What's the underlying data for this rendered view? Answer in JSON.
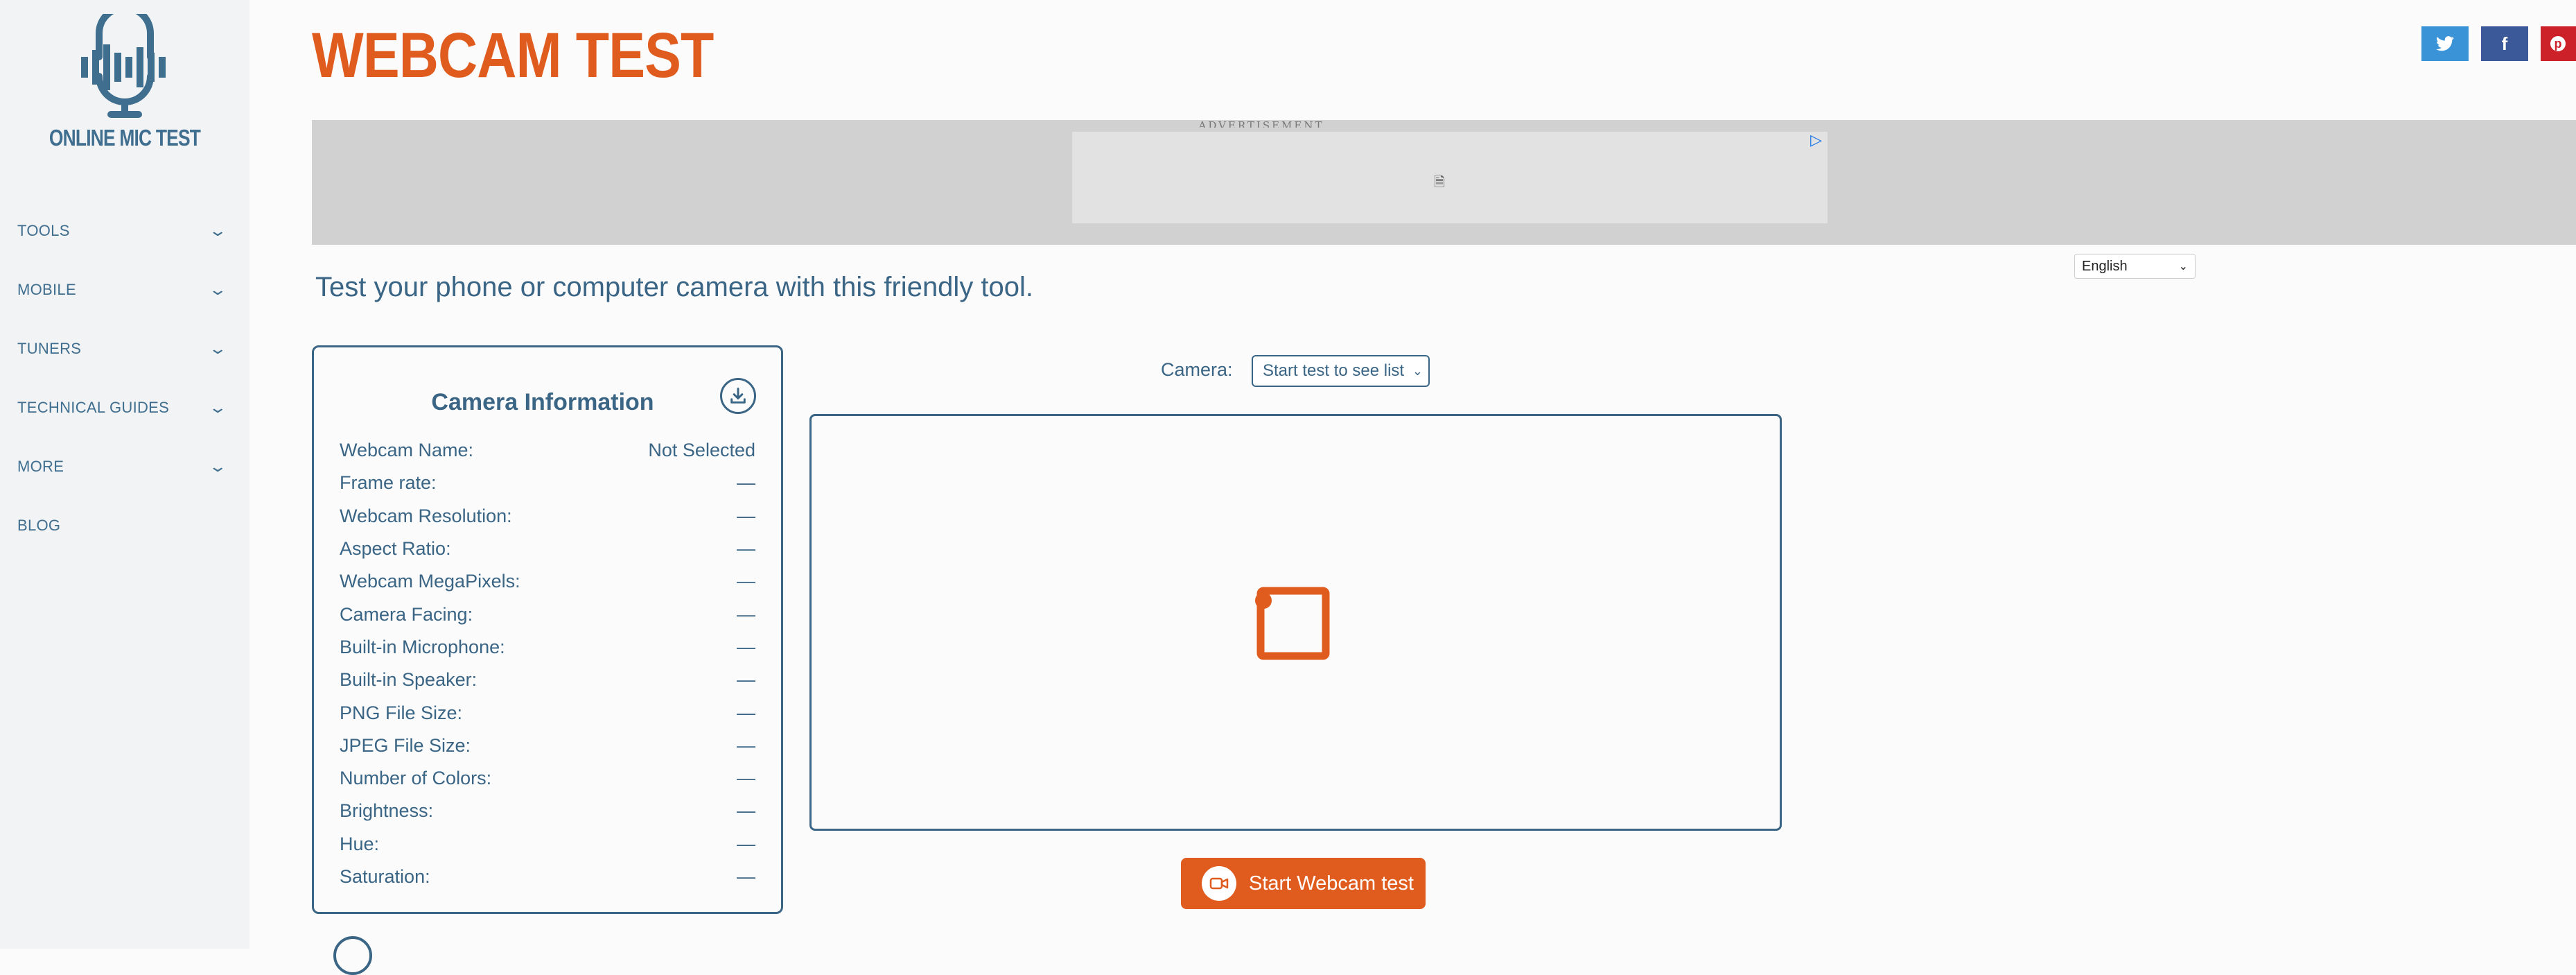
{
  "sidebar": {
    "logo_text": "ONLINE MIC TEST",
    "items": [
      {
        "label": "TOOLS"
      },
      {
        "label": "MOBILE"
      },
      {
        "label": "TUNERS"
      },
      {
        "label": "TECHNICAL GUIDES"
      },
      {
        "label": "MORE"
      },
      {
        "label": "BLOG"
      }
    ]
  },
  "page": {
    "title": "WEBCAM TEST",
    "subtitle": "Test your phone or computer camera with this friendly tool.",
    "ad_label": "ADVERTISEMENT",
    "language": "English"
  },
  "social": {
    "twitter_icon": "twitter-icon",
    "facebook_icon": "facebook-icon",
    "pinterest_icon": "pinterest-icon"
  },
  "camera_info": {
    "title": "Camera Information",
    "rows": [
      {
        "label": "Webcam Name:",
        "value": "Not Selected"
      },
      {
        "label": "Frame rate:",
        "value": "—"
      },
      {
        "label": "Webcam Resolution:",
        "value": "—"
      },
      {
        "label": "Aspect Ratio:",
        "value": "—"
      },
      {
        "label": "Webcam MegaPixels:",
        "value": "—"
      },
      {
        "label": "Camera Facing:",
        "value": "—"
      },
      {
        "label": "Built-in Microphone:",
        "value": "—"
      },
      {
        "label": "Built-in Speaker:",
        "value": "—"
      },
      {
        "label": "PNG File Size:",
        "value": "—"
      },
      {
        "label": "JPEG File Size:",
        "value": "—"
      },
      {
        "label": "Number of Colors:",
        "value": "—"
      },
      {
        "label": "Brightness:",
        "value": "—"
      },
      {
        "label": "Hue:",
        "value": "—"
      },
      {
        "label": "Saturation:",
        "value": "—"
      }
    ]
  },
  "camera": {
    "label": "Camera:",
    "select_value": "Start test to see list",
    "start_button": "Start Webcam test"
  },
  "colors": {
    "accent": "#e05c1e",
    "primary": "#3a6585"
  }
}
